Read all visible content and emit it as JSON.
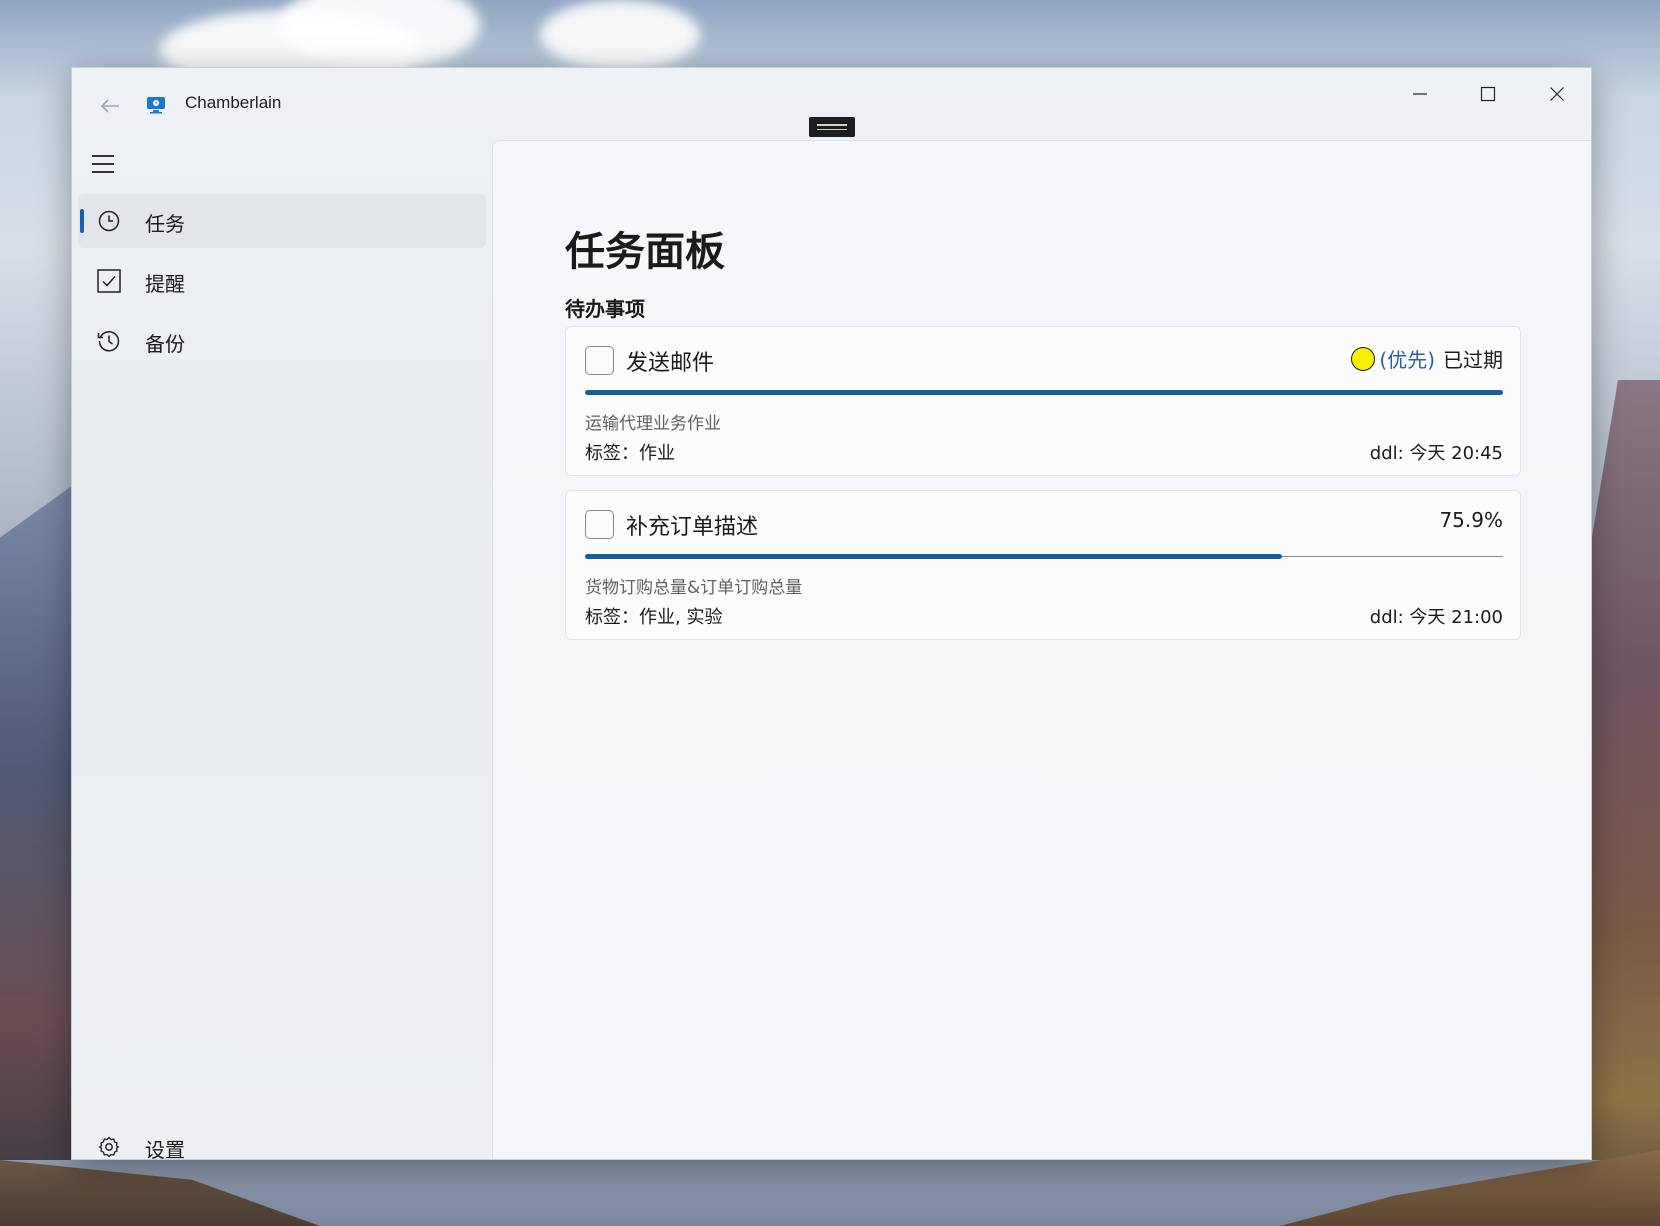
{
  "app": {
    "title": "Chamberlain"
  },
  "sidebar": {
    "items": [
      {
        "label": "任务",
        "icon": "clock-icon",
        "active": true
      },
      {
        "label": "提醒",
        "icon": "checkbox-icon",
        "active": false
      },
      {
        "label": "备份",
        "icon": "history-icon",
        "active": false
      }
    ],
    "settings_label": "设置"
  },
  "main": {
    "page_title": "任务面板",
    "section_title": "待办事项",
    "tasks": [
      {
        "name": "发送邮件",
        "priority": "(优先)",
        "status": "已过期",
        "percent": "",
        "progress": 1.0,
        "description": "运输代理业务作业",
        "tags": "标签：作业",
        "ddl": "ddl: 今天 20:45"
      },
      {
        "name": "补充订单描述",
        "priority": "",
        "status": "",
        "percent": "75.9%",
        "progress": 0.759,
        "description": "货物订购总量&订单订购总量",
        "tags": "标签：作业, 实验",
        "ddl": "ddl: 今天 21:00"
      }
    ]
  },
  "colors": {
    "accent": "#1a5c96",
    "priority_dot": "#f6f000",
    "priority_text": "#2d5f9e"
  }
}
